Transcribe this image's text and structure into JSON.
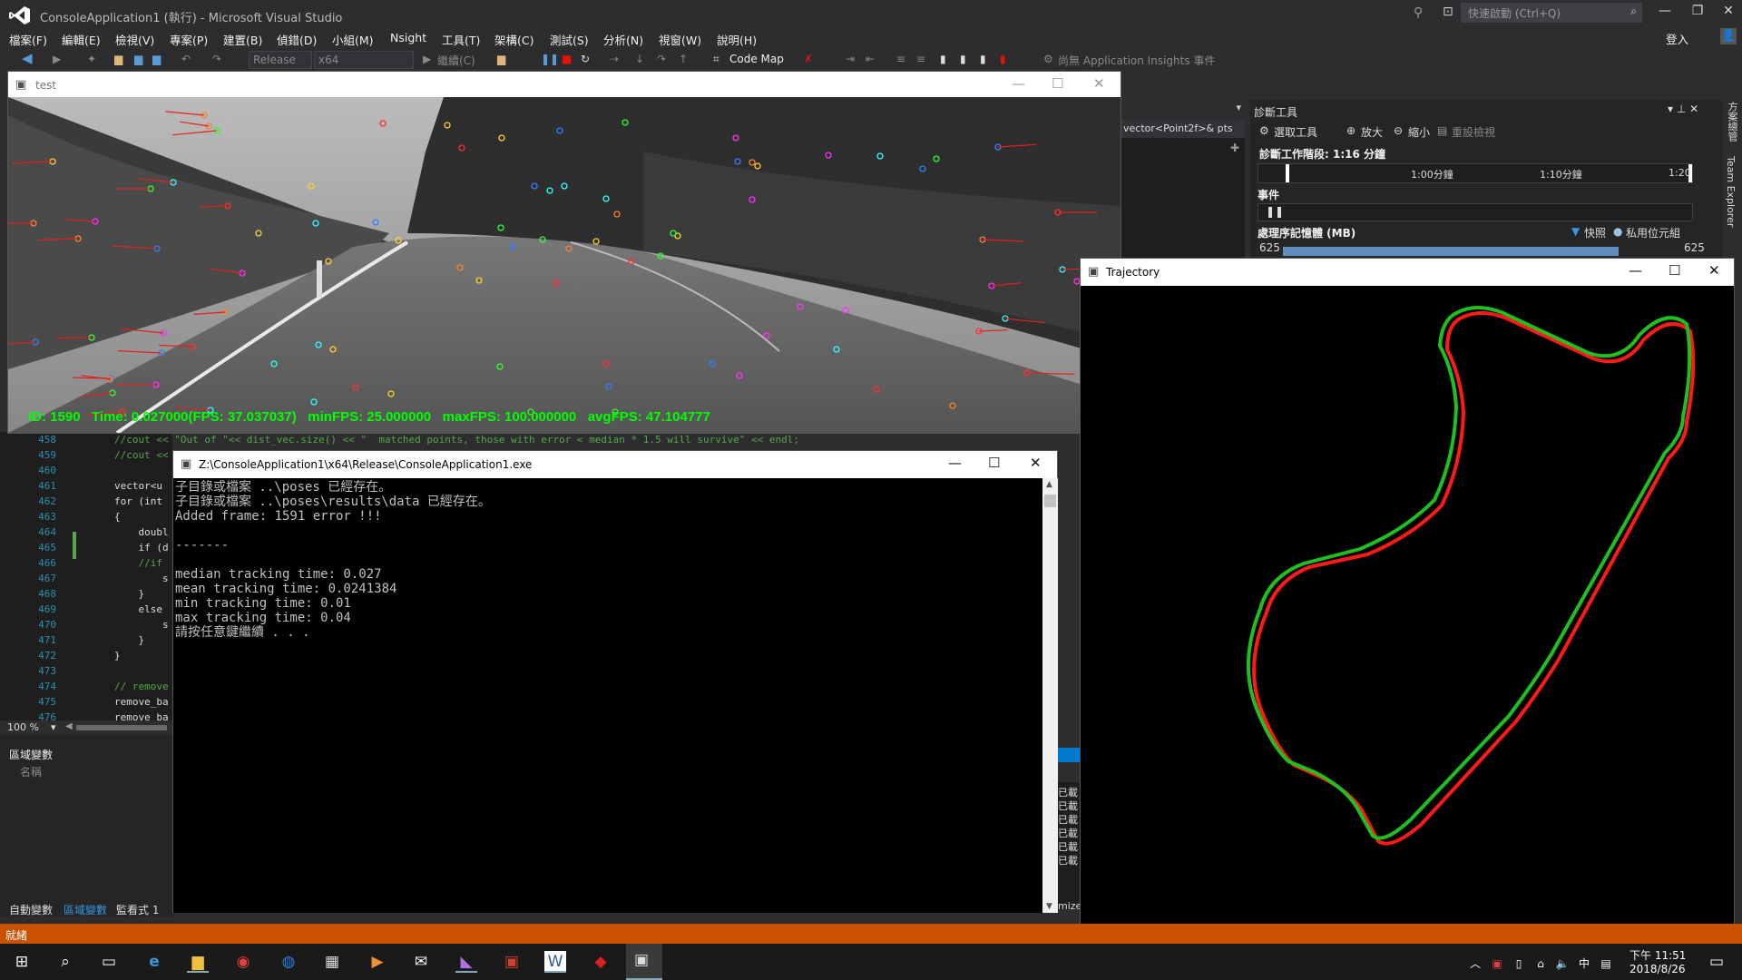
{
  "app": {
    "title": "ConsoleApplication1 (執行) - Microsoft Visual Studio",
    "quick_launch": "快速啟動 (Ctrl+Q)",
    "signin": "登入"
  },
  "menu": [
    "檔案(F)",
    "編輯(E)",
    "檢視(V)",
    "專案(P)",
    "建置(B)",
    "偵錯(D)",
    "小組(M)",
    "Nsight",
    "工具(T)",
    "架構(C)",
    "測試(S)",
    "分析(N)",
    "視窗(W)",
    "說明(H)"
  ],
  "toolbar": {
    "config": "Release",
    "platform": "x64",
    "continue": "繼續(C)",
    "codemap": "Code Map",
    "insights": "尚無 Application Insights 事件"
  },
  "context_dropdown": "vector<Point2f>& pts",
  "diagnostics": {
    "title": "診斷工具",
    "select_tool": "選取工具",
    "zoom_in": "放大",
    "zoom_out": "縮小",
    "reset_view": "重設檢視",
    "session": "診斷工作階段: 1:16 分鐘",
    "ticks": [
      "1:00分鐘",
      "1:10分鐘",
      "1:20"
    ],
    "events": "事件",
    "memory": "處理序記憶體 (MB)",
    "snapshot": "快照",
    "private_bytes": "私用位元組",
    "mem_value_left": "625",
    "mem_value_right": "625"
  },
  "side_tabs": [
    "方案總管",
    "Team Explorer"
  ],
  "test_window": {
    "title": "test",
    "overlay": "ID: 1590   Time: 0.027000(FPS: 37.037037)   minFPS: 25.000000   maxFPS: 100.000000   avgFPS: 47.104777"
  },
  "code": {
    "lines": [
      {
        "n": "458",
        "t": "//cout << \"Out of \"<< dist_vec.size() << \"  matched points, those with error < median * 1.5 will survive\" << endl;"
      },
      {
        "n": "459",
        "t": "//cout <<"
      },
      {
        "n": "460",
        "t": ""
      },
      {
        "n": "461",
        "t": "vector<u"
      },
      {
        "n": "462",
        "t": "for (int"
      },
      {
        "n": "463",
        "t": "{"
      },
      {
        "n": "464",
        "t": "    doubl"
      },
      {
        "n": "465",
        "t": "    if (d"
      },
      {
        "n": "466",
        "t": "    //if"
      },
      {
        "n": "467",
        "t": "        s"
      },
      {
        "n": "468",
        "t": "    }"
      },
      {
        "n": "469",
        "t": "    else"
      },
      {
        "n": "470",
        "t": "        s"
      },
      {
        "n": "471",
        "t": "    }"
      },
      {
        "n": "472",
        "t": "}"
      },
      {
        "n": "473",
        "t": ""
      },
      {
        "n": "474",
        "t": "// remove"
      },
      {
        "n": "475",
        "t": "remove_ba"
      },
      {
        "n": "476",
        "t": "remove_ba"
      }
    ],
    "zoom": "100 %"
  },
  "locals": {
    "title": "區域變數",
    "column": "名稱",
    "tabs": [
      "自動變數",
      "區域變數",
      "監看式 1"
    ]
  },
  "console": {
    "title": "Z:\\ConsoleApplication1\\x64\\Release\\ConsoleApplication1.exe",
    "lines": [
      "子目錄或檔案 ..\\poses 已經存在。",
      "子目錄或檔案 ..\\poses\\results\\data 已經存在。",
      "Added frame: 1591 error !!!",
      "",
      "-------",
      "",
      "median tracking time: 0.027",
      "mean tracking time: 0.0241384",
      "min tracking time: 0.01",
      "max tracking time: 0.04",
      "請按任意鍵繼續 . . ."
    ]
  },
  "output_fragments": [
    "已載",
    "已載",
    "已載",
    "已載",
    "已載",
    "已載",
    "mize"
  ],
  "trajectory": {
    "title": "Trajectory",
    "colors": {
      "truth": "#ff1a1a",
      "estimate": "#1fbf1f"
    }
  },
  "status": "就緒",
  "clock": {
    "time": "下午 11:51",
    "date": "2018/8/26"
  },
  "ime": "中"
}
